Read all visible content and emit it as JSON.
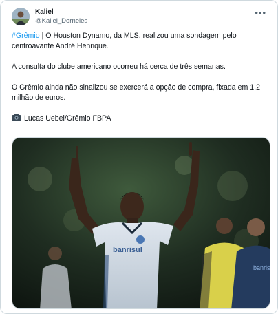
{
  "author": {
    "display_name": "Kaliel",
    "handle": "@Kaliel_Dorneles"
  },
  "menu": {
    "more_icon": "more-horizontal-icon",
    "more_label": "•••"
  },
  "tweet": {
    "hashtag": "#Grêmio",
    "line1_rest": " | O Houston Dynamo, da MLS, realizou uma sondagem pelo centroavante André Henrique.",
    "paragraph2": "A consulta do clube americano ocorreu há cerca de três semanas.",
    "paragraph3": "O Grêmio ainda não sinalizou se exercerá a opção de compra, fixada em 1.2 milhão de euros.",
    "photo_credit": "Lucas Uebel/Grêmio FBPA"
  },
  "media": {
    "shirt_sponsor": "banrisul",
    "opponent_sponsor": "banrisul"
  },
  "colors": {
    "hashtag": "#1d9bf0",
    "text": "#0f1419",
    "secondary": "#536471",
    "border": "#cfd9de"
  }
}
